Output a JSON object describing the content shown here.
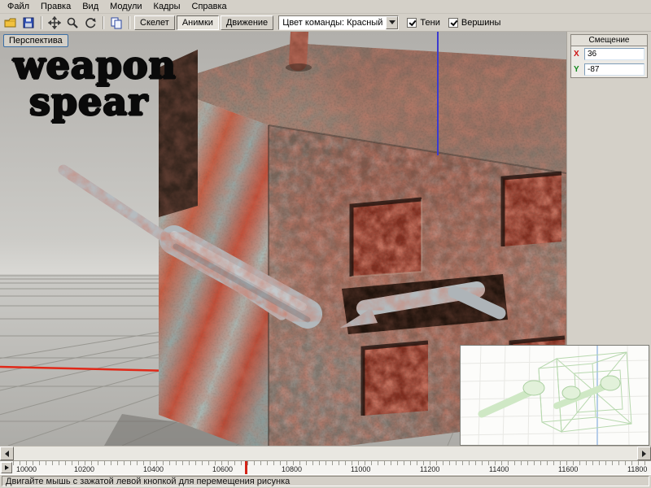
{
  "colors": {
    "chrome": "#d4d0c8",
    "axis_x_red": "#e02818",
    "axis_blue": "#3b3bd0",
    "offset_x_label": "#cc1414",
    "offset_y_label": "#11881c",
    "ruler_marker": "#d32418"
  },
  "menu": {
    "items": [
      "Файл",
      "Правка",
      "Вид",
      "Модули",
      "Кадры",
      "Справка"
    ]
  },
  "toolbar": {
    "icons": [
      "open-folder",
      "save",
      "pan",
      "zoom",
      "rotate",
      "copy"
    ],
    "mode_buttons": [
      {
        "label": "Скелет",
        "active": false
      },
      {
        "label": "Анимки",
        "active": true
      },
      {
        "label": "Движение",
        "active": false
      }
    ],
    "team_color_combo": "Цвет команды: Красный",
    "checkboxes": [
      {
        "label": "Тени",
        "checked": true
      },
      {
        "label": "Вершины",
        "checked": true
      }
    ]
  },
  "view": {
    "perspective_button": "Перспектива",
    "overlay_line1": "weapon",
    "overlay_line2": "spear"
  },
  "offset_panel": {
    "title": "Смещение",
    "rows": [
      {
        "axis": "X",
        "value": "36"
      },
      {
        "axis": "Y",
        "value": "-87"
      }
    ]
  },
  "timeline": {
    "ticks": [
      "10000",
      "10200",
      "10400",
      "10600",
      "10800",
      "11000",
      "11200",
      "11400",
      "11600",
      "11800"
    ]
  },
  "status": {
    "text": "Двигайте мышь с зажатой левой кнопкой для перемещения  рисунка"
  }
}
